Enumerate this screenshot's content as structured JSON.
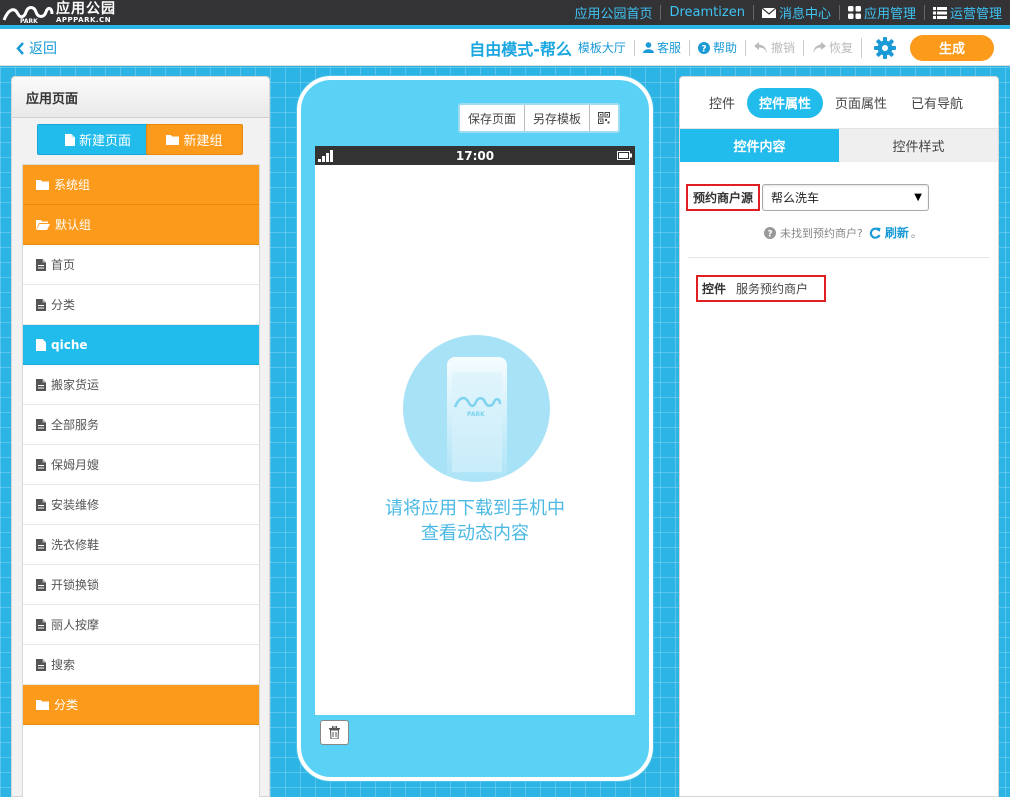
{
  "logo": {
    "cn": "应用公园",
    "en": "APPPARK.CN"
  },
  "topnav": {
    "home": "应用公园首页",
    "user": "Dreamtizen",
    "messages": "消息中心",
    "app_manage": "应用管理",
    "ops_manage": "运营管理"
  },
  "toolbar": {
    "back": "返回",
    "title": "自由模式-帮么",
    "template_hall": "模板大厅",
    "service": "客服",
    "help": "帮助",
    "undo": "撤销",
    "redo": "恢复",
    "generate": "生成"
  },
  "left_panel": {
    "title": "应用页面",
    "new_page": "新建页面",
    "new_group": "新建组",
    "items": [
      {
        "label": "系统组",
        "kind": "group",
        "icon": "folder-icon"
      },
      {
        "label": "默认组",
        "kind": "group",
        "icon": "folder-open-icon"
      },
      {
        "label": "首页",
        "kind": "page",
        "icon": "file-icon"
      },
      {
        "label": "分类",
        "kind": "page",
        "icon": "file-icon"
      },
      {
        "label": "qiche",
        "kind": "active",
        "icon": "file-icon"
      },
      {
        "label": "搬家货运",
        "kind": "page",
        "icon": "file-icon"
      },
      {
        "label": "全部服务",
        "kind": "page",
        "icon": "file-icon"
      },
      {
        "label": "保姆月嫂",
        "kind": "page",
        "icon": "file-icon"
      },
      {
        "label": "安装维修",
        "kind": "page",
        "icon": "file-icon"
      },
      {
        "label": "洗衣修鞋",
        "kind": "page",
        "icon": "file-icon"
      },
      {
        "label": "开锁换锁",
        "kind": "page",
        "icon": "file-icon"
      },
      {
        "label": "丽人按摩",
        "kind": "page",
        "icon": "file-icon"
      },
      {
        "label": "搜索",
        "kind": "page",
        "icon": "file-icon"
      },
      {
        "label": "分类",
        "kind": "group",
        "icon": "folder-icon"
      }
    ]
  },
  "phone": {
    "save_page": "保存页面",
    "save_template": "另存模板",
    "time": "17:00",
    "hint_line1": "请将应用下载到手机中",
    "hint_line2": "查看动态内容"
  },
  "right_panel": {
    "tabs": [
      "控件",
      "控件属性",
      "页面属性",
      "已有导航"
    ],
    "active_tab": 1,
    "subtabs": [
      "控件内容",
      "控件样式"
    ],
    "active_subtab": 0,
    "source_label": "预约商户源",
    "source_value": "帮么洗车",
    "not_found": "未找到预约商户?",
    "refresh": "刷新",
    "refresh_suffix": "。",
    "control_key": "控件",
    "control_value": "服务预约商户"
  },
  "colors": {
    "accent_blue": "#22bcec",
    "accent_orange": "#fb9a1b",
    "topbar": "#333336",
    "highlight_red": "#e02020"
  }
}
